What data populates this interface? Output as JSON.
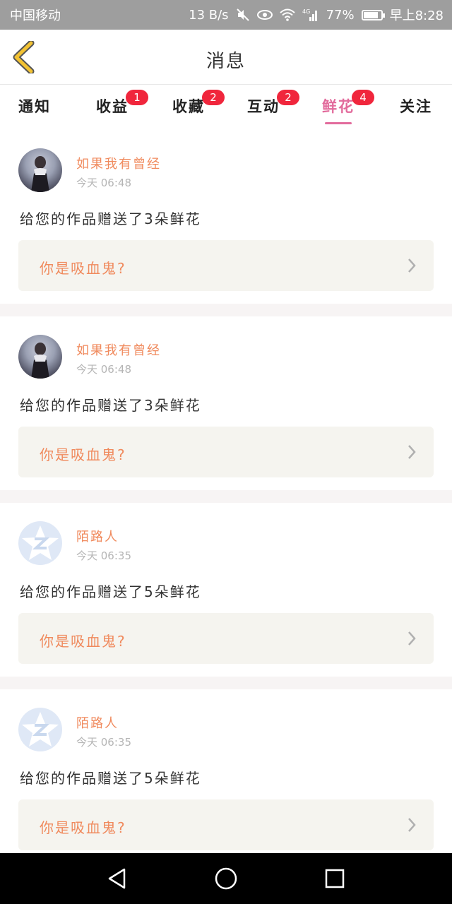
{
  "status_bar": {
    "carrier": "中国移动",
    "speed": "13 B/s",
    "network": "4G",
    "battery": "77%",
    "battery_level": 0.77,
    "time": "早上8:28"
  },
  "header": {
    "title": "消息",
    "back_icon": "chevron-left-icon"
  },
  "tabs": [
    {
      "label": "通知",
      "badge": ""
    },
    {
      "label": "收益",
      "badge": "1"
    },
    {
      "label": "收藏",
      "badge": "2"
    },
    {
      "label": "互动",
      "badge": "2"
    },
    {
      "label": "鲜花",
      "badge": "4",
      "active": true
    },
    {
      "label": "关注",
      "badge": ""
    }
  ],
  "messages": [
    {
      "username": "如果我有曾经",
      "time": "今天 06:48",
      "text": "给您的作品赠送了3朵鲜花",
      "work": "你是吸血鬼?",
      "avatar": "photo"
    },
    {
      "username": "如果我有曾经",
      "time": "今天 06:48",
      "text": "给您的作品赠送了3朵鲜花",
      "work": "你是吸血鬼?",
      "avatar": "photo"
    },
    {
      "username": "陌路人",
      "time": "今天 06:35",
      "text": "给您的作品赠送了5朵鲜花",
      "work": "你是吸血鬼?",
      "avatar": "default"
    },
    {
      "username": "陌路人",
      "time": "今天 06:35",
      "text": "给您的作品赠送了5朵鲜花",
      "work": "你是吸血鬼?",
      "avatar": "default"
    }
  ],
  "colors": {
    "accent": "#e26b9c",
    "name": "#f08a5d",
    "badge": "#f0263c",
    "back_arrow": "#f2c233"
  },
  "system_nav": [
    "back-triangle-icon",
    "home-circle-icon",
    "recents-square-icon"
  ]
}
